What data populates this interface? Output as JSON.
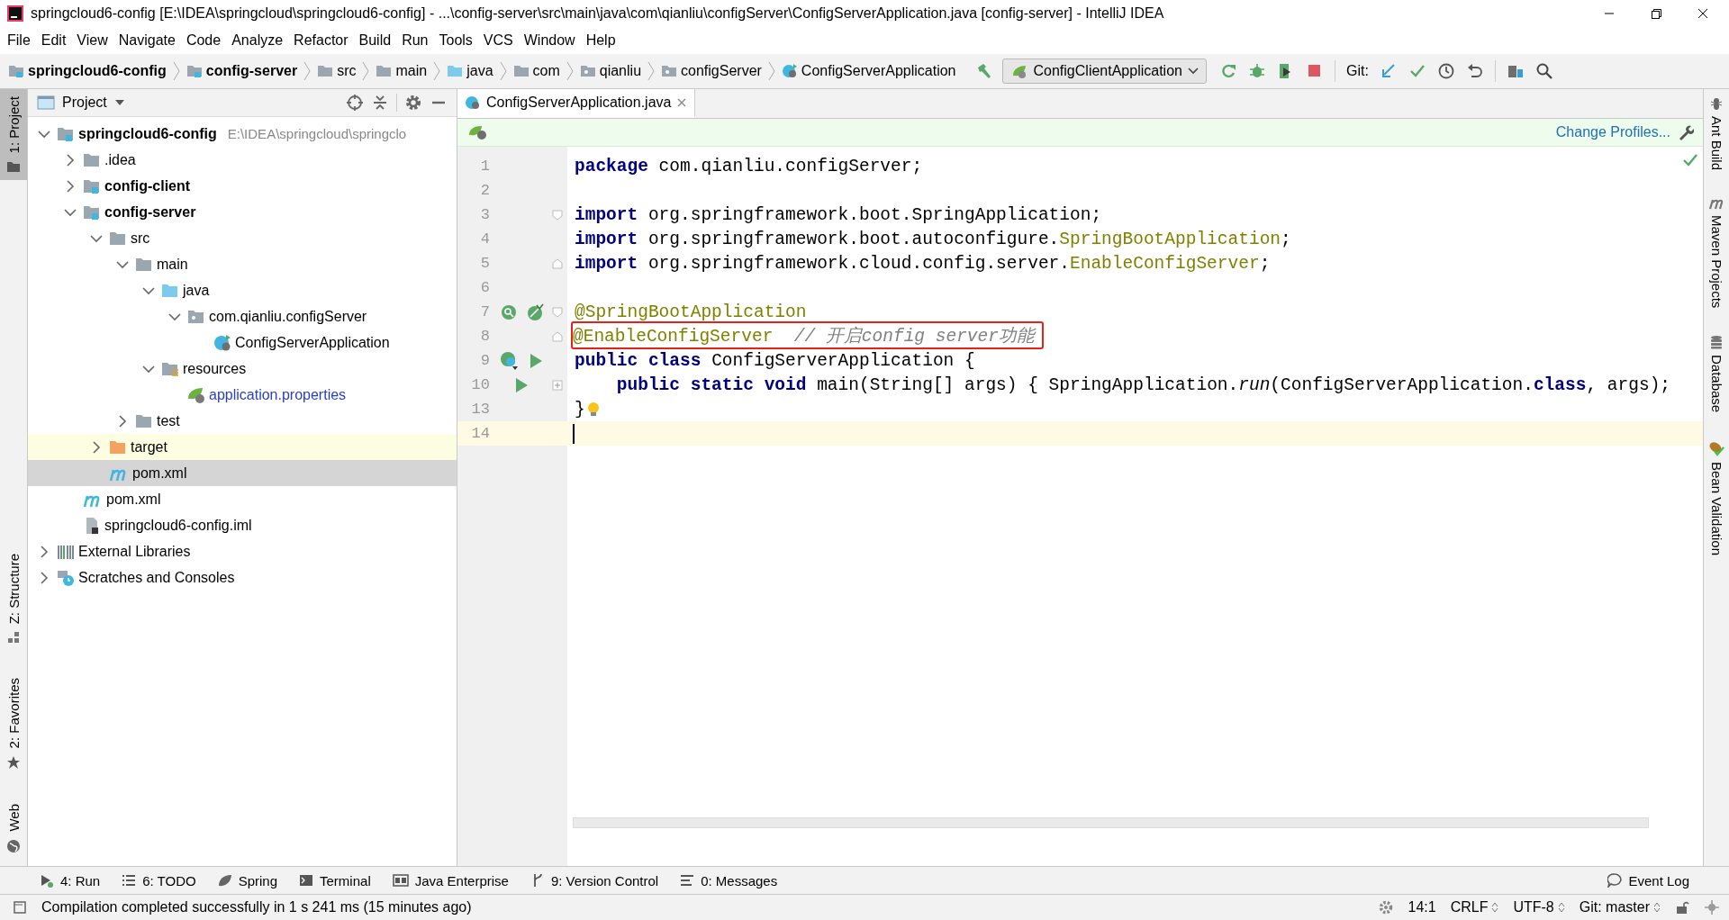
{
  "window": {
    "title": "springcloud6-config [E:\\IDEA\\springcloud\\springcloud6-config] - ...\\config-server\\src\\main\\java\\com\\qianliu\\configServer\\ConfigServerApplication.java [config-server] - IntelliJ IDEA"
  },
  "menu": [
    "File",
    "Edit",
    "View",
    "Navigate",
    "Code",
    "Analyze",
    "Refactor",
    "Build",
    "Run",
    "Tools",
    "VCS",
    "Window",
    "Help"
  ],
  "breadcrumbs": [
    {
      "label": "springcloud6-config",
      "kind": "module",
      "bold": true
    },
    {
      "label": "config-server",
      "kind": "module",
      "bold": true
    },
    {
      "label": "src",
      "kind": "folder",
      "bold": false
    },
    {
      "label": "main",
      "kind": "folder",
      "bold": false
    },
    {
      "label": "java",
      "kind": "source",
      "bold": false
    },
    {
      "label": "com",
      "kind": "folder",
      "bold": false
    },
    {
      "label": "qianliu",
      "kind": "package",
      "bold": false
    },
    {
      "label": "configServer",
      "kind": "package",
      "bold": false
    },
    {
      "label": "ConfigServerApplication",
      "kind": "spring-class",
      "bold": false
    }
  ],
  "run_config": {
    "label": "ConfigClientApplication"
  },
  "git_label": "Git:",
  "project_panel": {
    "title": "Project",
    "tree": [
      {
        "label": "springcloud6-config",
        "hint": "E:\\IDEA\\springcloud\\springclo",
        "kind": "module",
        "bold": true,
        "expanded": true,
        "selected": false,
        "children": [
          {
            "label": ".idea",
            "kind": "folder",
            "bold": false,
            "expanded": false,
            "selected": false
          },
          {
            "label": "config-client",
            "kind": "module",
            "bold": true,
            "expanded": false,
            "selected": false
          },
          {
            "label": "config-server",
            "kind": "module",
            "bold": true,
            "expanded": true,
            "selected": false,
            "children": [
              {
                "label": "src",
                "kind": "folder",
                "bold": false,
                "expanded": true,
                "selected": false,
                "children": [
                  {
                    "label": "main",
                    "kind": "folder",
                    "bold": false,
                    "expanded": true,
                    "selected": false,
                    "children": [
                      {
                        "label": "java",
                        "kind": "source",
                        "bold": false,
                        "expanded": true,
                        "selected": false,
                        "children": [
                          {
                            "label": "com.qianliu.configServer",
                            "kind": "package",
                            "bold": false,
                            "expanded": true,
                            "selected": false,
                            "children": [
                              {
                                "label": "ConfigServerApplication",
                                "kind": "spring-class",
                                "bold": false,
                                "selected": false
                              }
                            ]
                          }
                        ]
                      },
                      {
                        "label": "resources",
                        "kind": "resources",
                        "bold": false,
                        "expanded": true,
                        "selected": false,
                        "children": [
                          {
                            "label": "application.properties",
                            "kind": "spring-config",
                            "bold": false,
                            "selected": false
                          }
                        ]
                      }
                    ]
                  },
                  {
                    "label": "test",
                    "kind": "folder",
                    "bold": false,
                    "expanded": false,
                    "selected": false
                  }
                ]
              },
              {
                "label": "target",
                "kind": "excluded",
                "bold": false,
                "expanded": false,
                "selected": false
              },
              {
                "label": "pom.xml",
                "kind": "maven",
                "bold": false,
                "selected": true
              }
            ]
          },
          {
            "label": "pom.xml",
            "kind": "maven",
            "bold": false,
            "selected": false
          },
          {
            "label": "springcloud6-config.iml",
            "kind": "iml",
            "bold": false,
            "selected": false
          }
        ]
      },
      {
        "label": "External Libraries",
        "kind": "libraries",
        "bold": false,
        "expanded": false,
        "selected": false
      },
      {
        "label": "Scratches and Consoles",
        "kind": "scratches",
        "bold": false,
        "expanded": false,
        "selected": false
      }
    ]
  },
  "editor": {
    "tabs": [
      {
        "label": "ConfigServerApplication.java",
        "selected": true
      }
    ],
    "banner_link": "Change Profiles...",
    "lines": [
      {
        "number": "1",
        "boxed": false,
        "current": false,
        "segments": [
          {
            "text": "package",
            "kind": "keyword"
          },
          {
            "text": " com.qianliu.configServer;",
            "kind": "plain"
          }
        ]
      },
      {
        "number": "2",
        "boxed": false,
        "current": false
      },
      {
        "number": "3",
        "boxed": false,
        "current": false,
        "fold": {
          "kind": "start"
        },
        "segments": [
          {
            "text": "import",
            "kind": "keyword"
          },
          {
            "text": " org.springframework.boot.SpringApplication;",
            "kind": "plain"
          }
        ]
      },
      {
        "number": "4",
        "boxed": false,
        "current": false,
        "segments": [
          {
            "text": "import",
            "kind": "keyword"
          },
          {
            "text": " org.springframework.boot.autoconfigure.",
            "kind": "plain"
          },
          {
            "text": "SpringBootApplication",
            "kind": "annotation"
          },
          {
            "text": ";",
            "kind": "plain"
          }
        ]
      },
      {
        "number": "5",
        "boxed": false,
        "current": false,
        "fold": {
          "kind": "end"
        },
        "segments": [
          {
            "text": "import",
            "kind": "keyword"
          },
          {
            "text": " org.springframework.cloud.config.server.",
            "kind": "plain"
          },
          {
            "text": "EnableConfigServer",
            "kind": "annotation"
          },
          {
            "text": ";",
            "kind": "plain"
          }
        ]
      },
      {
        "number": "6",
        "boxed": false,
        "current": false
      },
      {
        "number": "7",
        "boxed": false,
        "current": false,
        "fold": {
          "kind": "start"
        },
        "gutter": [
          {
            "kind": "bean-search"
          },
          {
            "kind": "spring-bean"
          }
        ],
        "segments": [
          {
            "text": "@SpringBootApplication",
            "kind": "annotation"
          }
        ]
      },
      {
        "number": "8",
        "boxed": true,
        "current": false,
        "fold": {
          "kind": "end"
        },
        "segments": [
          {
            "text": "@EnableConfigServer",
            "kind": "annotation"
          },
          {
            "text": "  // 开启config server功能",
            "kind": "comment"
          }
        ]
      },
      {
        "number": "9",
        "boxed": false,
        "current": false,
        "gutter": [
          {
            "kind": "spring-class"
          },
          {
            "kind": "run"
          }
        ],
        "segments": [
          {
            "text": "public class",
            "kind": "keyword"
          },
          {
            "text": " ConfigServerApplication {",
            "kind": "plain"
          }
        ]
      },
      {
        "number": "10",
        "boxed": false,
        "current": false,
        "fold": {
          "kind": "closed"
        },
        "gutter": [
          {
            "kind": "run"
          }
        ],
        "segments": [
          {
            "text": "    public static void",
            "kind": "keyword"
          },
          {
            "text": " main(String[] args) ",
            "kind": "plain"
          },
          {
            "text": "{ ",
            "kind": "plain"
          },
          {
            "text": "SpringApplication.",
            "kind": "plain"
          },
          {
            "text": "run",
            "kind": "italic"
          },
          {
            "text": "(ConfigServerApplication.",
            "kind": "plain"
          },
          {
            "text": "class",
            "kind": "keyword"
          },
          {
            "text": ", args);",
            "kind": "plain"
          }
        ]
      },
      {
        "number": "13",
        "boxed": false,
        "current": false,
        "inline_icon": {
          "kind": "bulb"
        },
        "segments": [
          {
            "text": "}",
            "kind": "plain"
          }
        ]
      },
      {
        "number": "14",
        "boxed": false,
        "current": true
      }
    ]
  },
  "left_strip": [
    {
      "label": "1: Project",
      "kind": "project",
      "selected": true
    },
    {
      "label": "Z: Structure",
      "kind": "structure",
      "selected": false
    },
    {
      "label": "2: Favorites",
      "kind": "favorites",
      "selected": false
    },
    {
      "label": "Web",
      "kind": "web",
      "selected": false
    }
  ],
  "right_strip": [
    {
      "label": "Ant Build",
      "kind": "ant"
    },
    {
      "label": "Maven Projects",
      "kind": "maven"
    },
    {
      "label": "Database",
      "kind": "database"
    },
    {
      "label": "Bean Validation",
      "kind": "bean"
    }
  ],
  "tool_windows": [
    {
      "label": "4: Run",
      "kind": "run"
    },
    {
      "label": "6: TODO",
      "kind": "todo"
    },
    {
      "label": "Spring",
      "kind": "spring"
    },
    {
      "label": "Terminal",
      "kind": "terminal"
    },
    {
      "label": "Java Enterprise",
      "kind": "javaee"
    },
    {
      "label": "9: Version Control",
      "kind": "vcs"
    },
    {
      "label": "0: Messages",
      "kind": "messages"
    }
  ],
  "event_log": "Event Log",
  "status_bar": {
    "message": "Compilation completed successfully in 1 s 241 ms (15 minutes ago)",
    "position": "14:1",
    "line_separator": "CRLF",
    "encoding": "UTF-8",
    "vcs_branch": "Git: master"
  }
}
